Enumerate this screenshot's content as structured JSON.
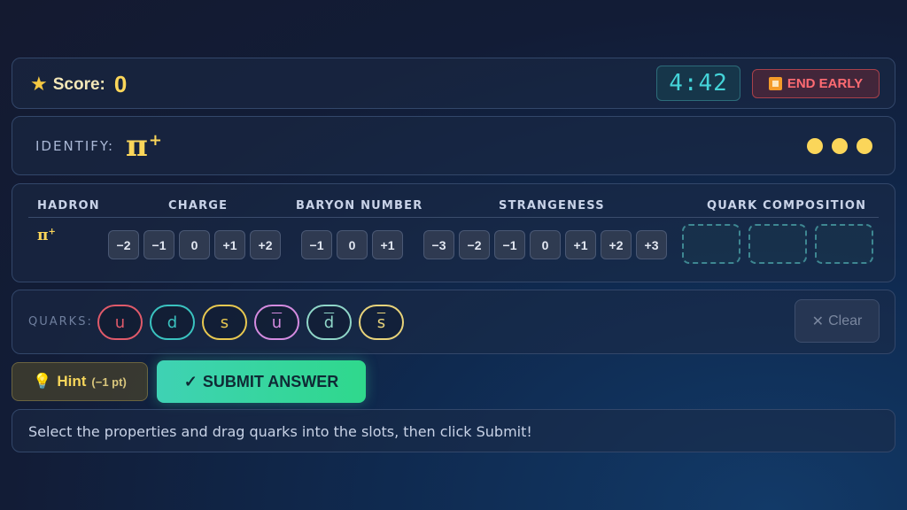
{
  "header": {
    "score_label": "Score:",
    "score_value": "0",
    "timer": "4:42",
    "end_label": "END EARLY",
    "colors": {
      "accent": "#fbd65a",
      "timer": "#44d3d8",
      "danger": "#ff6b72"
    }
  },
  "identify": {
    "label": "IDENTIFY:",
    "particle": "π",
    "particle_charge": "+",
    "lives": 3
  },
  "table": {
    "headers": [
      "HADRON",
      "CHARGE",
      "BARYON NUMBER",
      "STRANGENESS",
      "QUARK COMPOSITION"
    ],
    "hadron": "π",
    "hadron_charge": "+",
    "charge_options": [
      "−2",
      "−1",
      "0",
      "+1",
      "+2"
    ],
    "baryon_options": [
      "−1",
      "0",
      "+1"
    ],
    "strangeness_options": [
      "−3",
      "−2",
      "−1",
      "0",
      "+1",
      "+2",
      "+3"
    ],
    "slots": 3
  },
  "quarks": {
    "label": "QUARKS:",
    "items": [
      {
        "symbol": "u",
        "anti": false,
        "color": "#e05a6a"
      },
      {
        "symbol": "d",
        "anti": false,
        "color": "#3ac3c0"
      },
      {
        "symbol": "s",
        "anti": false,
        "color": "#e8c850"
      },
      {
        "symbol": "u",
        "anti": true,
        "color": "#d48be0"
      },
      {
        "symbol": "d",
        "anti": true,
        "color": "#8fd6c8"
      },
      {
        "symbol": "s",
        "anti": true,
        "color": "#e8d37a"
      }
    ],
    "clear_label": "Clear"
  },
  "actions": {
    "hint_label": "Hint",
    "hint_cost": "(−1 pt)",
    "submit_label": "SUBMIT ANSWER"
  },
  "status": "Select the properties and drag quarks into the slots, then click Submit!"
}
